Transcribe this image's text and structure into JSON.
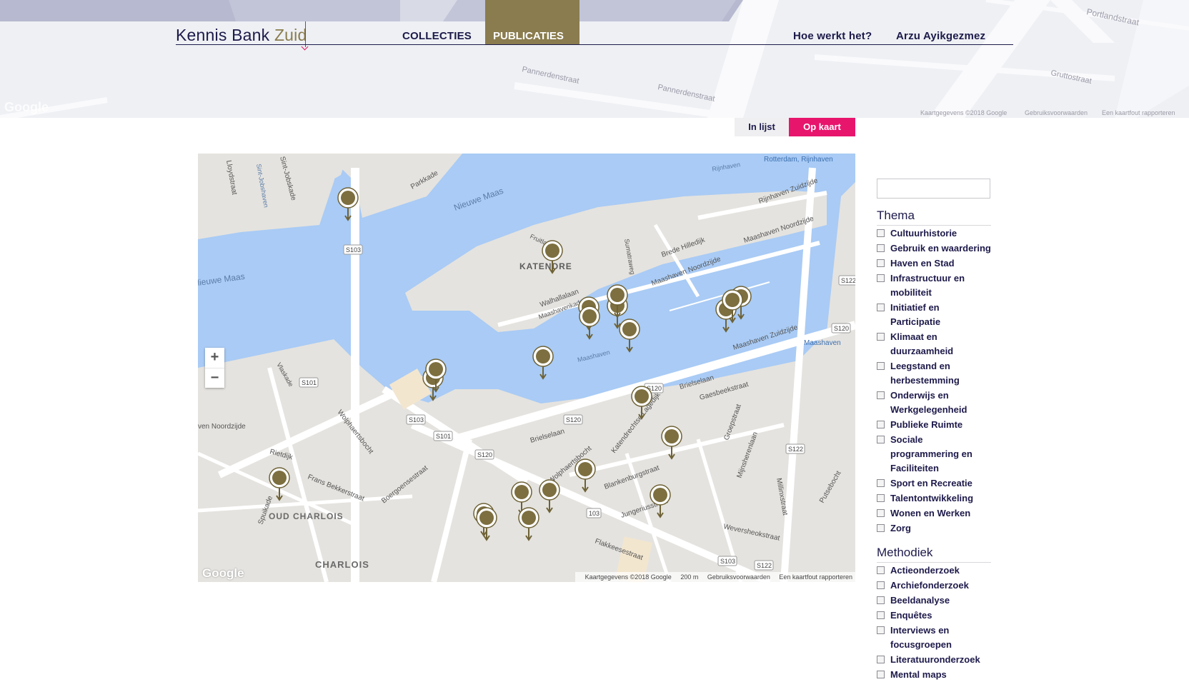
{
  "header": {
    "logo_main": "Kennis Bank",
    "logo_accent": "Zuid",
    "nav": {
      "collecties": "COLLECTIES",
      "publicaties": "PUBLICATIES",
      "hoe": "Hoe werkt het?",
      "user": "Arzu Ayikgezmez"
    },
    "credit": {
      "data": "Kaartgegevens ©2018 Google",
      "terms": "Gebruiksvoorwaarden",
      "report": "Een kaartfout rapporteren"
    },
    "google": "Google"
  },
  "view_toggle": {
    "list": "In lijst",
    "map": "Op kaart"
  },
  "map": {
    "labels": {
      "katendrecht": "KATENDRE",
      "oud_charlois": "OUD CHARLOIS",
      "charlois": "CHARLOIS",
      "nieuwe_maas": "Nieuwe Maas",
      "nieuwe_maas2": "lieuwe Maas",
      "maashaven": "Maashaven",
      "rijnhaven": "Rijnhaven",
      "station_rijnhaven": "Rotterdam, Rijnhaven",
      "station_maashaven": "Maashaven",
      "parkkade": "Parkkade",
      "fruitlaan": "Fruitlaan",
      "sumatraweg": "Sumatraweg",
      "brede_hilledijk": "Brede Hilledijk",
      "maashaven_nz": "Maashaven Noordzijde",
      "maashaven_nz2": "Maashaven Noordzijde",
      "walhallalaan": "Walhallalaan",
      "maashavenkade": "Maashavenkade",
      "maashaven_zz": "Maashaven Zuidzijde",
      "rijnhaven_zz": "Rijnhaven Zuidzijde",
      "brielselaan": "Brielselaan",
      "brielselaan2": "Brielselaan",
      "gaesbeekstraat": "Gaesbeekstraat",
      "wolphaertsbocht": "Wolphaertsbocht",
      "wolphaertsbocht2": "Wolphaertsbocht",
      "katendrechtse_lagedijk": "Katendrechtse Lagedijk",
      "blankenburgstraat": "Blankenburgstraat",
      "jungeriusstraat": "Jungeriusstraat",
      "flakkeesestraat": "Flakkeesestraat",
      "frans_bekkerstraat": "Frans Bekkerstraat",
      "boergoensestraat": "Boergoensestraat",
      "riedijk": "Rietdijk",
      "spuikade": "Spuikade",
      "vlaskade": "Vlaskade",
      "lloydstraat": "Lloydstraat",
      "sint_jobshaven": "Sint-Jobshaven",
      "sint_jobskade": "Sint-Jobskade",
      "heven_nz": "ven Noordzijde",
      "weversstraat": "Weversheokstraat",
      "putsebocht": "Putsebocht",
      "millinxstraat": "Millinxstraat",
      "groepstraat": "Groepstraat",
      "mijnsherenlaan": "Mijnsherenlaan",
      "s103a": "S103",
      "s103b": "S103",
      "s101a": "S101",
      "s101b": "S101",
      "s120a": "S120",
      "s120b": "S120",
      "s120c": "S120",
      "s120d": "S120",
      "s122a": "S122",
      "s122b": "S122",
      "s122c": "S122",
      "s103c": "S103",
      "s103d": "103"
    },
    "zoom_in": "+",
    "zoom_out": "−",
    "google": "Google",
    "credit": {
      "data": "Kaartgegevens ©2018 Google",
      "scale": "200 m",
      "terms": "Gebruiksvoorwaarden",
      "report": "Een kaartfout rapporteren"
    }
  },
  "filters": {
    "search_placeholder": "",
    "thema_title": "Thema",
    "thema": [
      "Cultuurhistorie",
      "Gebruik en waardering",
      "Haven en Stad",
      "Infrastructuur en mobiliteit",
      "Initiatief en Participatie",
      "Klimaat en duurzaamheid",
      "Leegstand en herbestemming",
      "Onderwijs en Werkgelegenheid",
      "Publieke Ruimte",
      "Sociale programmering en Faciliteiten",
      "Sport en Recreatie",
      "Talentontwikkeling",
      "Wonen en Werken",
      "Zorg"
    ],
    "methodiek_title": "Methodiek",
    "methodiek": [
      "Actieonderzoek",
      "Archiefonderzoek",
      "Beeldanalyse",
      "Enquêtes",
      "Interviews en focusgroepen",
      "Literatuuronderzoek",
      "Mental maps"
    ]
  },
  "colors": {
    "primary": "#1d1a4a",
    "accent": "#8a7c4e",
    "pink": "#e8156d",
    "water": "#a9cbf5"
  }
}
